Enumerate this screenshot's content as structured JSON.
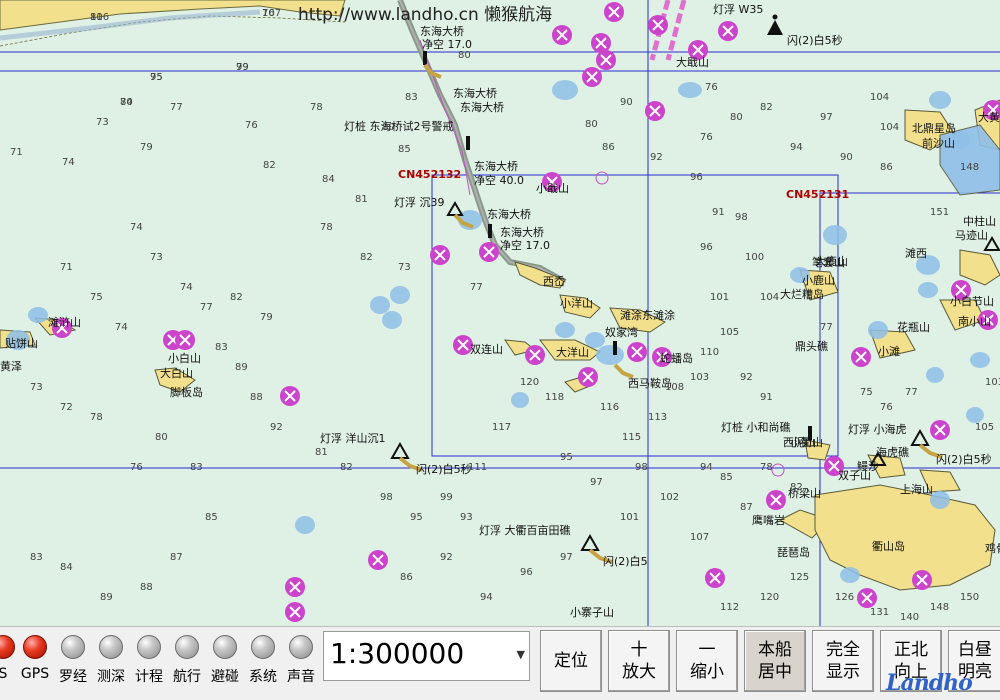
{
  "watermark": "http://www.landho.cn  懒猴航海",
  "chart_cells": [
    "CN452132",
    "CN452131"
  ],
  "place_names": [
    "大戢山",
    "北鼎星岛",
    "前沙山",
    "小戢山",
    "西岙",
    "小洋山",
    "滩涂",
    "东滩涂",
    "大洋山",
    "西马鞍岛",
    "蛇蟠岛",
    "奴家湾",
    "双连山",
    "大白山",
    "小白山",
    "脚板岛",
    "滩浒山",
    "黄泽",
    "小鹿山",
    "大鹿山",
    "笔套山",
    "大烂糟岛",
    "马迹山",
    "中柱山",
    "小白节山",
    "南小山",
    "花瓶山",
    "小滩",
    "鼎头礁",
    "西泥山",
    "小衢山",
    "鳗沙",
    "双子山",
    "上海山",
    "桥梁山",
    "鹰嘴岩",
    "衢山岛",
    "琵琶岛",
    "小寨子山",
    "大黄",
    "贴饼山",
    "鸡骨",
    "滩西"
  ],
  "navaids": [
    "灯浮 W35",
    "闪(2)白5秒",
    "东海大桥",
    "净空 17.0",
    "东海大桥",
    "东海大桥",
    "灯桩 东海桥试2号警戒",
    "东海大桥",
    "净空 40.0",
    "灯浮 沉39",
    "东海大桥",
    "东海大桥",
    "净空 17.0",
    "灯浮 洋山沉1",
    "闪(2)白5秒",
    "灯浮 大衢百亩田礁",
    "闪(2)白5",
    "灯桩 小和尚礁",
    "灯浮 小海虎",
    "海虎礁",
    "闪(2)白5秒"
  ],
  "depths": [
    "81",
    "76",
    "79",
    "75",
    "74",
    "73",
    "71",
    "74",
    "77",
    "76",
    "79",
    "82",
    "78",
    "83",
    "80",
    "80",
    "85",
    "84",
    "81",
    "78",
    "82",
    "73",
    "77",
    "80",
    "86",
    "90",
    "92",
    "96",
    "91",
    "96",
    "98",
    "100",
    "104",
    "105",
    "103",
    "101",
    "110",
    "108",
    "113",
    "115",
    "116",
    "118",
    "120",
    "117",
    "111",
    "99",
    "95",
    "98",
    "82",
    "81",
    "92",
    "88",
    "89",
    "83",
    "82",
    "79",
    "77",
    "74",
    "73",
    "74",
    "71",
    "75",
    "74",
    "73",
    "72",
    "78",
    "76",
    "80",
    "83",
    "85",
    "87",
    "88",
    "89",
    "84",
    "83",
    "86",
    "92",
    "93",
    "94",
    "96",
    "97",
    "101",
    "102",
    "107",
    "112",
    "120",
    "125",
    "126",
    "131",
    "140",
    "148",
    "150",
    "151",
    "148",
    "104",
    "104",
    "97",
    "94",
    "90",
    "86",
    "82",
    "80",
    "76",
    "76",
    "77",
    "75",
    "76",
    "77",
    "78",
    "82",
    "87",
    "85",
    "91",
    "92",
    "94",
    "95",
    "97",
    "98",
    "103",
    "105",
    "106",
    "107",
    "99",
    "95",
    "80"
  ],
  "indicators": [
    {
      "label": "S",
      "state": "on"
    },
    {
      "label": "GPS",
      "state": "on"
    },
    {
      "label": "罗经",
      "state": "off"
    },
    {
      "label": "测深",
      "state": "off"
    },
    {
      "label": "计程",
      "state": "off"
    },
    {
      "label": "航行",
      "state": "off"
    },
    {
      "label": "避碰",
      "state": "off"
    },
    {
      "label": "系统",
      "state": "off"
    },
    {
      "label": "声音",
      "state": "off"
    }
  ],
  "scale": {
    "value": "1:300000"
  },
  "buttons": [
    {
      "label": "定位"
    },
    {
      "label": "十\n放大"
    },
    {
      "label": "一\n缩小"
    },
    {
      "label": "本船\n居中"
    },
    {
      "label": "完全\n显示"
    },
    {
      "label": "正北\n向上"
    },
    {
      "label": "白昼\n明亮"
    }
  ],
  "brand": {
    "logo": "Landho"
  },
  "colors": {
    "sea": "#dff0e4",
    "land": "#f2e08c",
    "danger": "#cc44cc",
    "shallow": "#8fbfe8",
    "grid": "#2b2bd6",
    "cell": "#b00000",
    "bridge": "#8a9a8a"
  }
}
